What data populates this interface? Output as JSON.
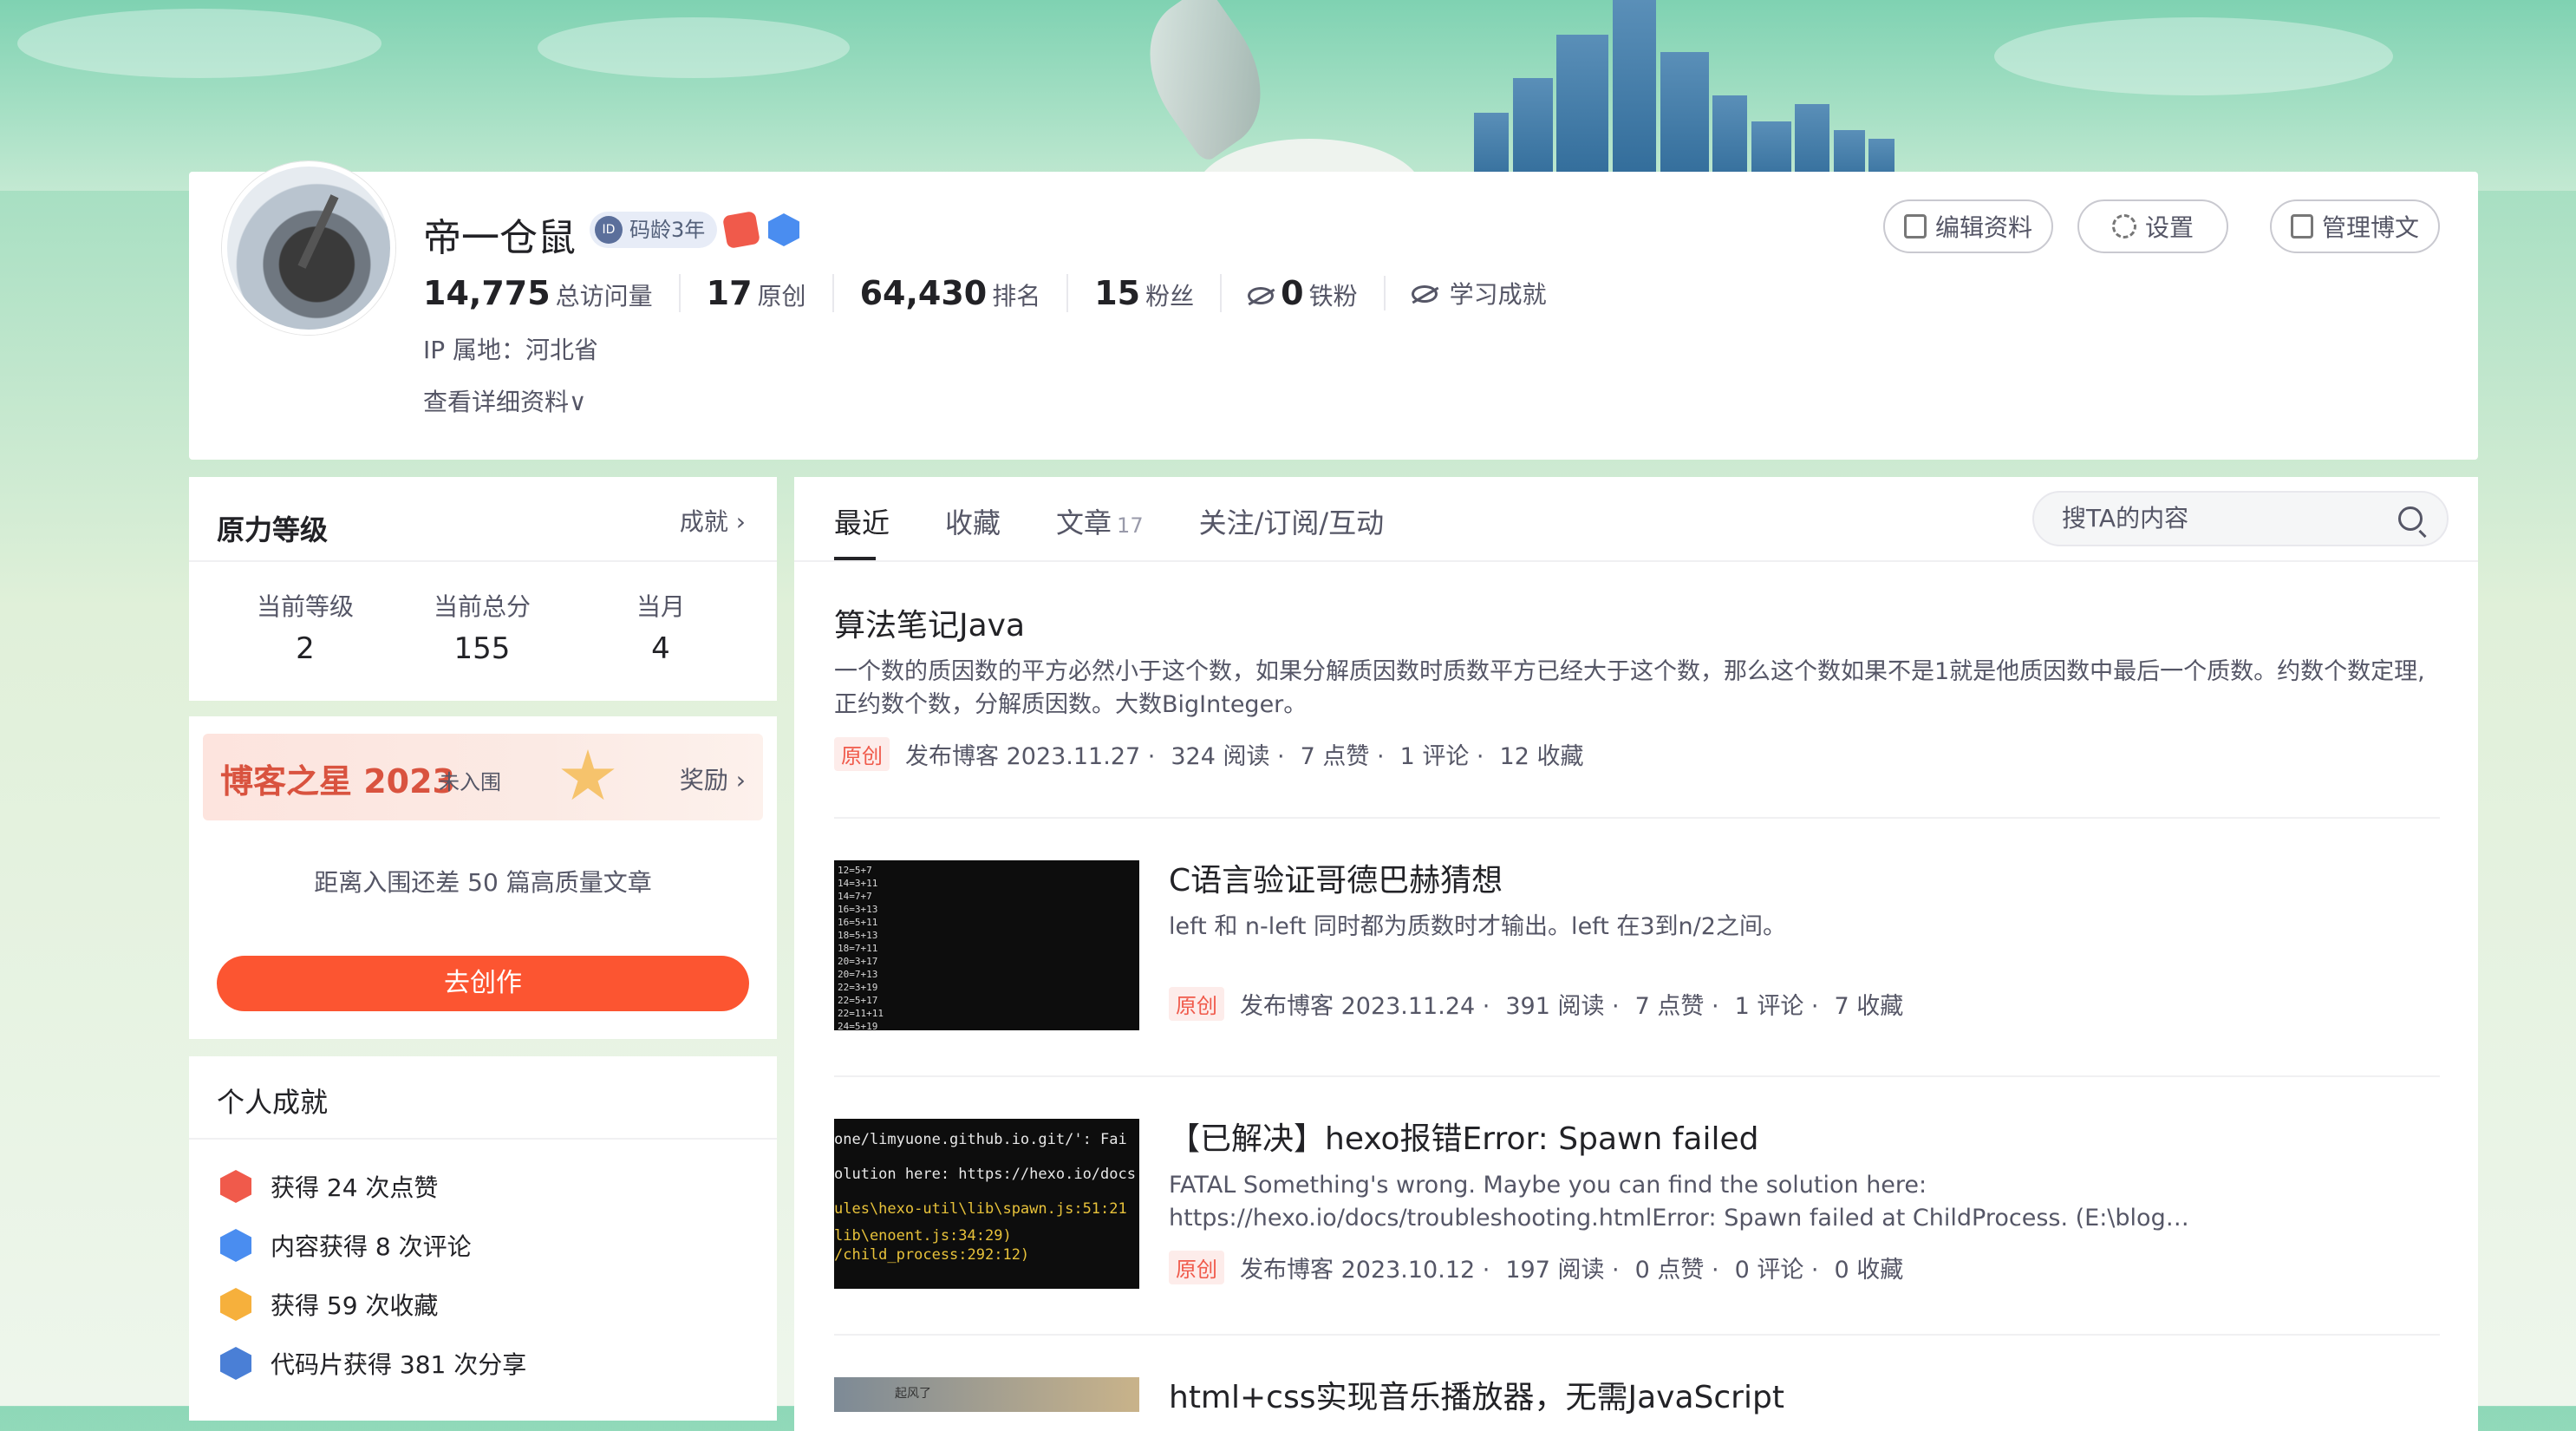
{
  "profile": {
    "username": "帝一仓鼠",
    "code_age": "码龄3年",
    "code_age_icon": "ID",
    "stats": [
      {
        "num": "14,775",
        "label": "总访问量"
      },
      {
        "num": "17",
        "label": "原创"
      },
      {
        "num": "64,430",
        "label": "排名"
      },
      {
        "num": "15",
        "label": "粉丝"
      },
      {
        "num": "0",
        "label": "铁粉"
      }
    ],
    "learning": "学习成就",
    "ip": "IP 属地：河北省",
    "more": "查看详细资料∨",
    "buttons": {
      "edit": "编辑资料",
      "settings": "设置",
      "manage": "管理博文"
    }
  },
  "level": {
    "title": "原力等级",
    "link": "成就 ›",
    "items": [
      {
        "label": "当前等级",
        "value": "2"
      },
      {
        "label": "当前总分",
        "value": "155"
      },
      {
        "label": "当月",
        "value": "4"
      }
    ]
  },
  "star": {
    "title": "博客之星 2023",
    "status": "未入围",
    "link": "奖励 ›",
    "gap_text": "距离入围还差 50 篇高质量文章",
    "button": "去创作"
  },
  "achievements": {
    "title": "个人成就",
    "items": [
      {
        "text": "获得 24 次点赞",
        "color": "#f05a4b"
      },
      {
        "text": "内容获得 8 次评论",
        "color": "#4a8df0"
      },
      {
        "text": "获得 59 次收藏",
        "color": "#f6b03c"
      },
      {
        "text": "代码片获得 381 次分享",
        "color": "#4a7fd6"
      }
    ]
  },
  "tabs": {
    "items": [
      "最近",
      "收藏",
      "文章",
      "关注/订阅/互动"
    ],
    "article_count": "17",
    "search_placeholder": "搜TA的内容"
  },
  "articles": [
    {
      "title": "算法笔记Java",
      "desc": "一个数的质因数的平方必然小于这个数，如果分解质因数时质数平方已经大于这个数，那么这个数如果不是1就是他质因数中最后一个质数。约数个数定理,正约数个数，分解质因数。大数BigInteger。",
      "tag": "原创",
      "date": "发布博客 2023.11.27 ·",
      "reads": "324 阅读 ·",
      "likes": "7 点赞 ·",
      "comments": "1 评论 ·",
      "favs": "12 收藏"
    },
    {
      "title": "C语言验证哥德巴赫猜想",
      "desc": "left 和 n-left 同时都为质数时才输出。left 在3到n/2之间。",
      "tag": "原创",
      "date": "发布博客 2023.11.24 ·",
      "reads": "391 阅读 ·",
      "likes": "7 点赞 ·",
      "comments": "1 评论 ·",
      "favs": "7 收藏",
      "thumb_lines": [
        "12=5+7",
        "14=3+11",
        "14=7+7",
        "16=3+13",
        "16=5+11",
        "18=5+13",
        "18=7+11",
        "20=3+17",
        "20=7+13",
        "22=3+19",
        "22=5+17",
        "22=11+11",
        "24=5+19"
      ]
    },
    {
      "title": "【已解决】hexo报错Error: Spawn failed",
      "desc": "FATAL Something's wrong. Maybe you can find the solution here: https://hexo.io/docs/troubleshooting.htmlError: Spawn failed at ChildProcess. (E:\\blog…",
      "tag": "原创",
      "date": "发布博客 2023.10.12 ·",
      "reads": "197 阅读 ·",
      "likes": "0 点赞 ·",
      "comments": "0 评论 ·",
      "favs": "0 收藏",
      "thumb_lines": [
        "one/limyuone.github.io.git/': Fai",
        "olution here: https://hexo.io/docs",
        "ules\\hexo-util\\lib\\spawn.js:51:21",
        "lib\\enoent.js:34:29)",
        "/child_process:292:12)"
      ]
    },
    {
      "title": "html+css实现音乐播放器，无需JavaScript",
      "thumb_caption": "起风了"
    }
  ]
}
